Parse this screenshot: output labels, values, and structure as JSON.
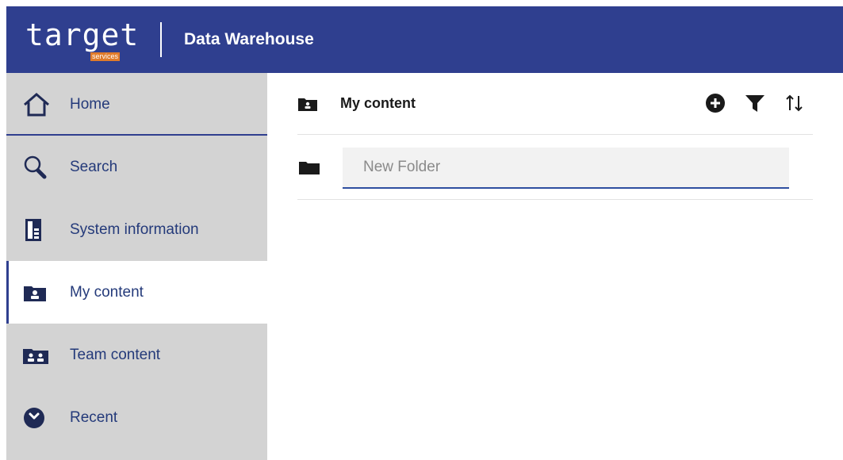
{
  "header": {
    "logo_text": "target",
    "logo_subtext": "services",
    "app_title": "Data Warehouse",
    "background": "#2f3f8f"
  },
  "sidebar": {
    "items": [
      {
        "label": "Home",
        "icon": "home-icon"
      },
      {
        "label": "Search",
        "icon": "search-icon"
      },
      {
        "label": "System information",
        "icon": "system-information-icon"
      },
      {
        "label": "My content",
        "icon": "my-content-icon",
        "selected": true
      },
      {
        "label": "Team content",
        "icon": "team-content-icon"
      },
      {
        "label": "Recent",
        "icon": "recent-icon"
      }
    ]
  },
  "main": {
    "title": "My content",
    "actions": [
      "add-icon",
      "filter-icon",
      "sort-icon"
    ],
    "new_folder": {
      "placeholder": "New Folder",
      "value": ""
    }
  },
  "colors": {
    "accent": "#2f3f8f",
    "sidebar_bg": "#d3d3d3",
    "nav_text": "#243a7a",
    "logo_orange": "#e07b2a"
  }
}
